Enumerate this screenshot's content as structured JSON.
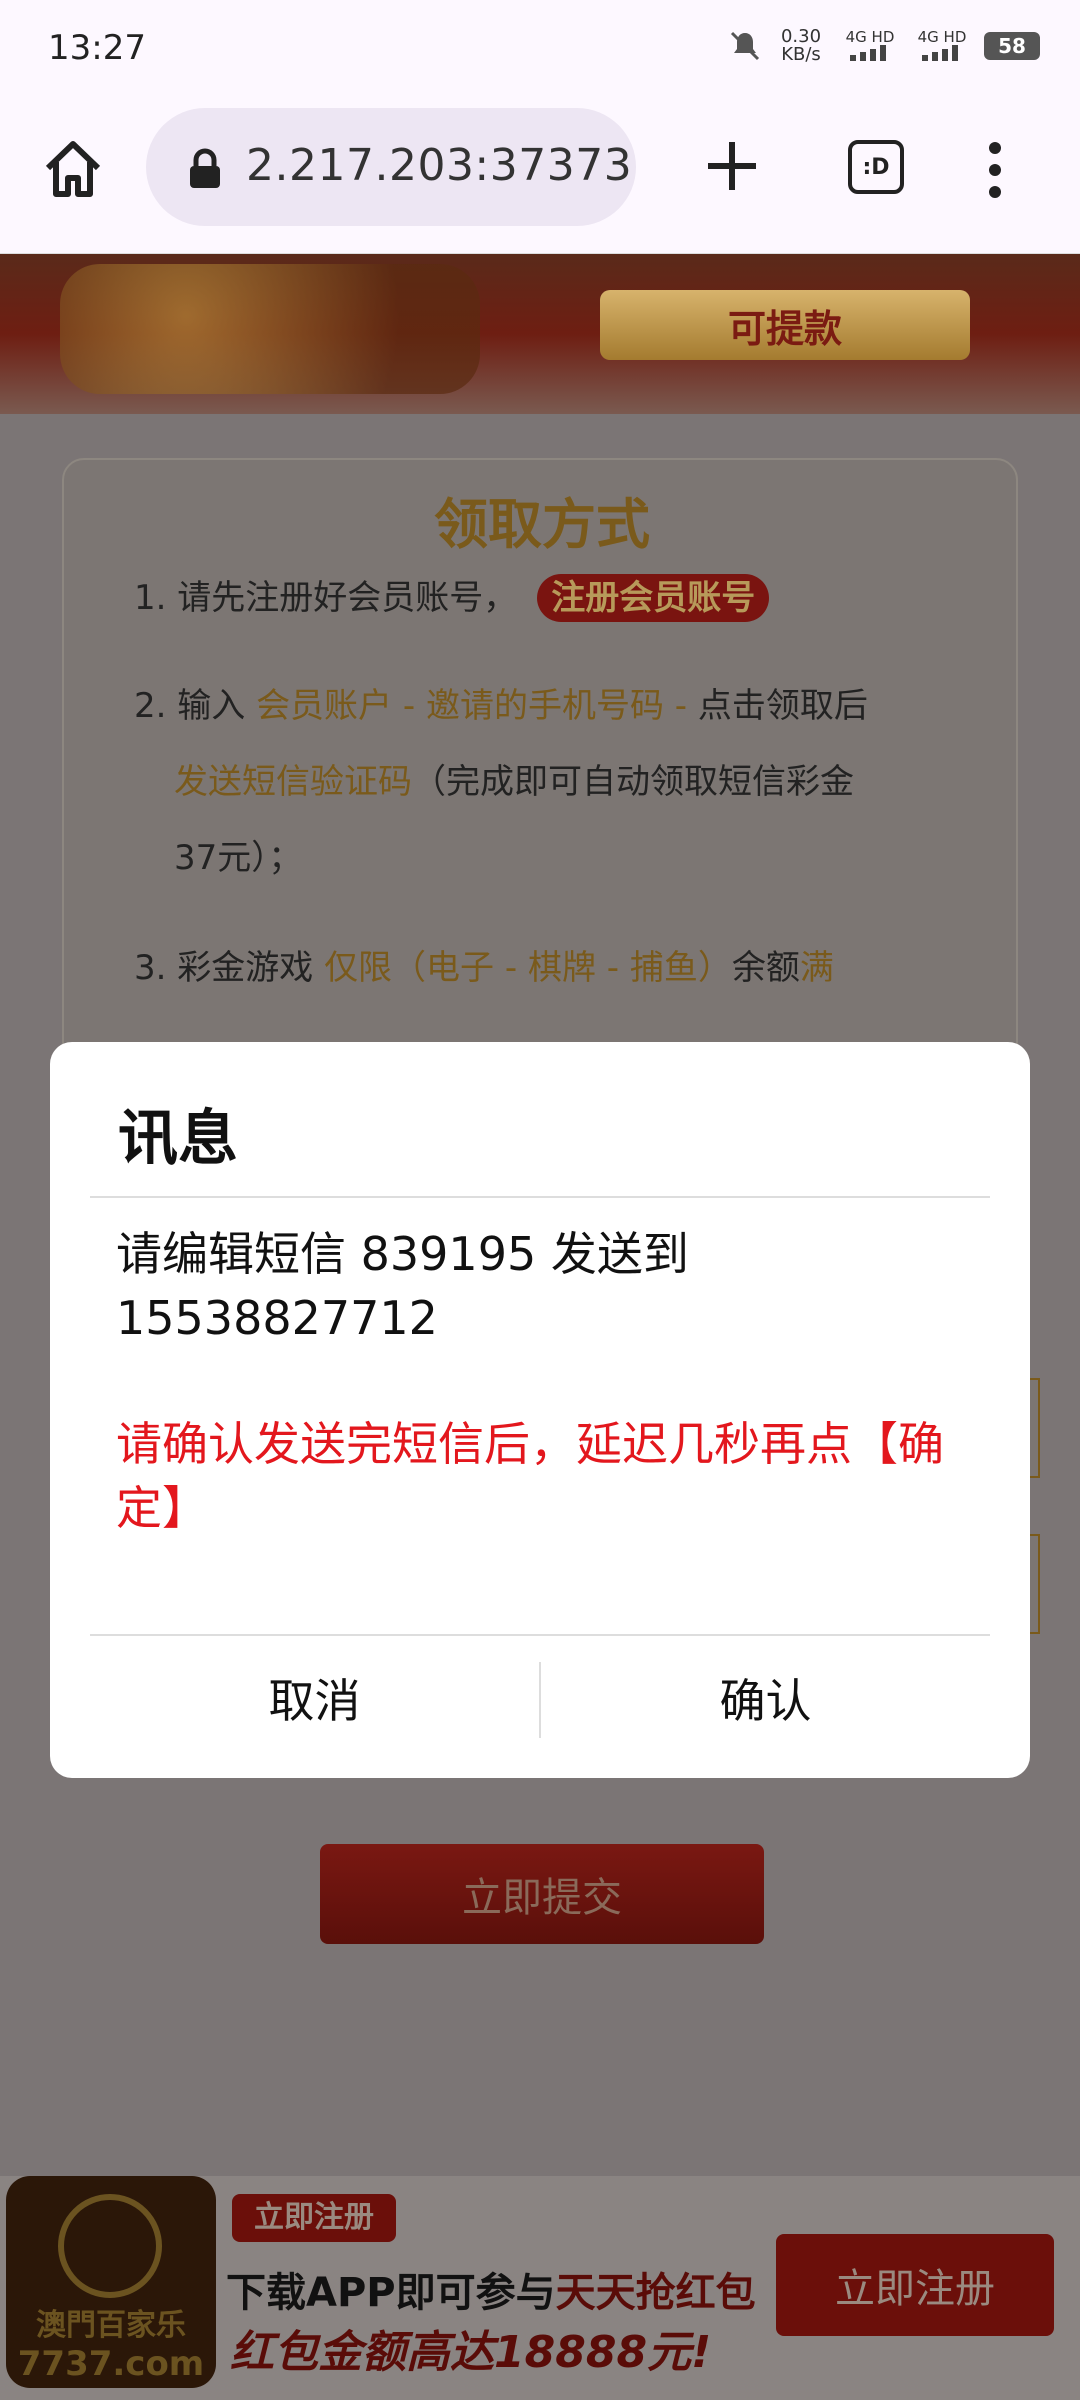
{
  "status": {
    "time": "13:27",
    "speed_value": "0.30",
    "speed_unit": "KB/s",
    "net1": "4G HD",
    "net2": "4G HD",
    "battery": "58"
  },
  "browser": {
    "url": "2.217.203:37373",
    "tabs_label": ":D"
  },
  "page": {
    "banner_button": "可提款",
    "card_title": "领取方式",
    "step1_text": "1. 请先注册好会员账号，",
    "step1_badge": "注册会员账号",
    "step2_prefix": "2. 输入 ",
    "step2_gold1": "会员账户 - 邀请的手机号码 - ",
    "step2_mid": "点击领取后",
    "step2_gold2": "发送短信验证码",
    "step2_suffix": "（完成即可自动领取短信彩金",
    "step2_line3": "37元）；",
    "step3_prefix": "3. 彩金游戏 ",
    "step3_gold": "仅限（电子 - 棋牌 - 捕鱼）",
    "step3_mid": "余额",
    "step3_gold2": "满",
    "submit_label": "立即提交"
  },
  "footer": {
    "logo_name": "澳門百家乐",
    "logo_site": "7737.com",
    "tag": "立即注册",
    "line1_prefix": "下载APP即可参与",
    "line1_red": "天天抢红包",
    "line2": "红包金额高达18888元!",
    "register_button": "立即注册"
  },
  "dialog": {
    "title": "讯息",
    "message": "请编辑短信 839195 发送到 15538827712",
    "warning": "请确认发送完短信后，延迟几秒再点【确定】",
    "cancel": "取消",
    "confirm": "确认"
  },
  "colors": {
    "warning": "#e3171d",
    "overlay": "#7b7575",
    "brand_red": "#6b0f0a"
  }
}
